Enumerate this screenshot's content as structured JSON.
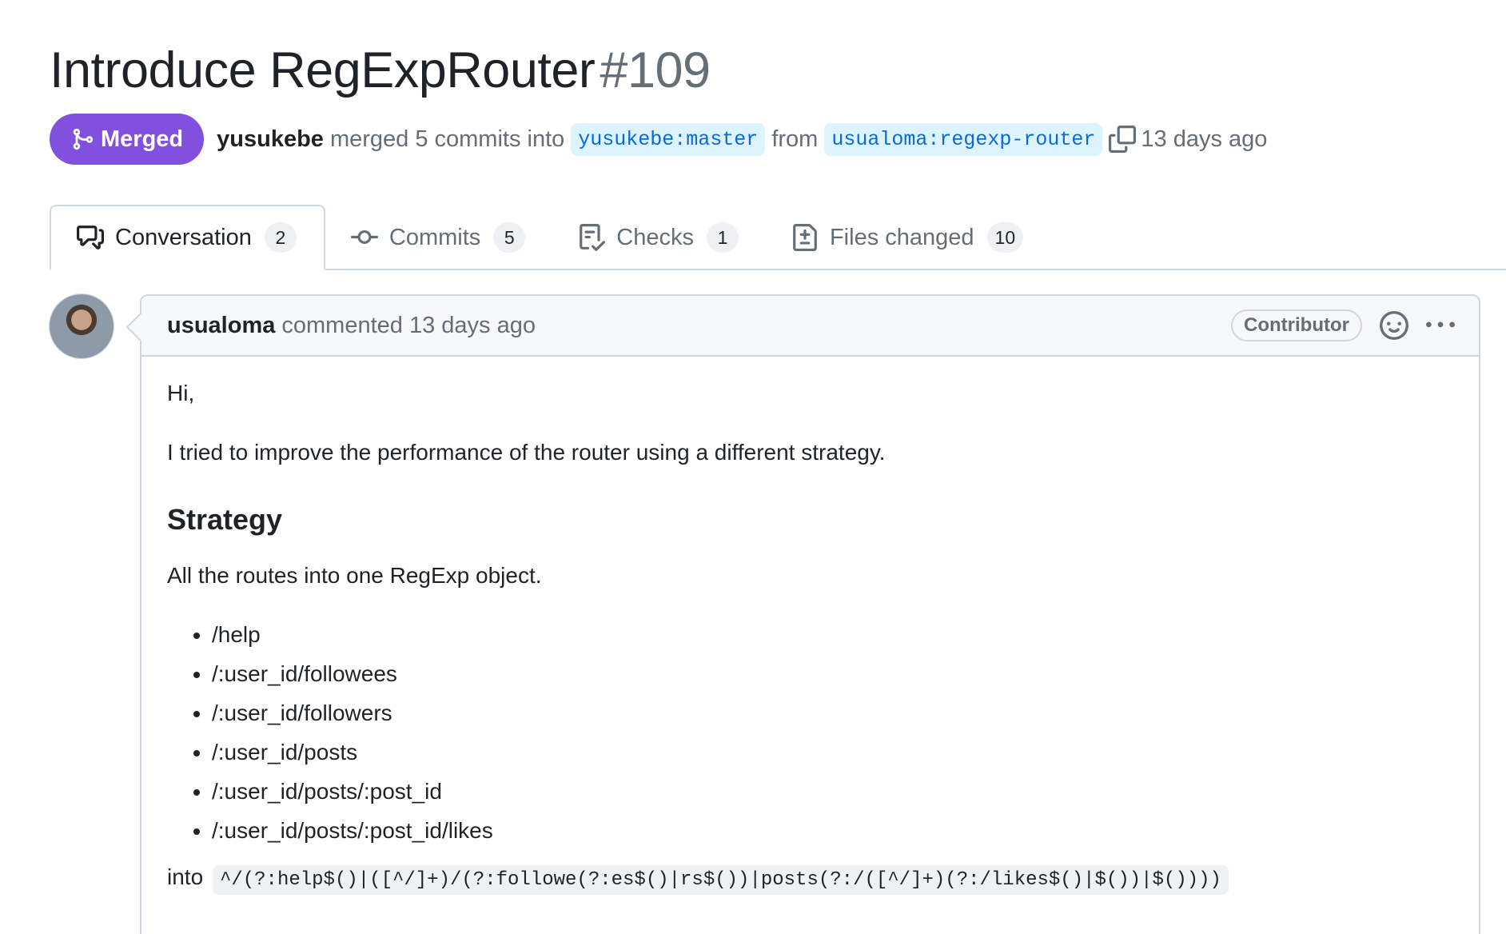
{
  "pr": {
    "title": "Introduce RegExpRouter",
    "number": "#109",
    "state": "Merged",
    "author": "yusukebe",
    "merge_text": "merged 5 commits into",
    "base_branch": "yusukebe:master",
    "from_text": "from",
    "head_branch": "usualoma:regexp-router",
    "time": "13 days ago"
  },
  "tabs": [
    {
      "label": "Conversation",
      "count": "2",
      "icon": "conversation-icon"
    },
    {
      "label": "Commits",
      "count": "5",
      "icon": "commit-icon"
    },
    {
      "label": "Checks",
      "count": "1",
      "icon": "checklist-icon"
    },
    {
      "label": "Files changed",
      "count": "10",
      "icon": "file-diff-icon"
    }
  ],
  "comment": {
    "author": "usualoma",
    "action": "commented 13 days ago",
    "role": "Contributor",
    "greeting": "Hi,",
    "intro": "I tried to improve the performance of the router using a different strategy.",
    "heading": "Strategy",
    "strategy_text": "All the routes into one RegExp object.",
    "routes": [
      "/help",
      "/:user_id/followees",
      "/:user_id/followers",
      "/:user_id/posts",
      "/:user_id/posts/:post_id",
      "/:user_id/posts/:post_id/likes"
    ],
    "into_label": "into",
    "regex": "^/(?:help$()|([^/]+)/(?:followe(?:es$()|rs$())|posts(?:/([^/]+)(?:/likes$()|$())|$())))"
  },
  "colors": {
    "merged": "#8250df",
    "branch_bg": "#ddf4ff",
    "branch_text": "#0969da",
    "muted": "#656d76"
  }
}
